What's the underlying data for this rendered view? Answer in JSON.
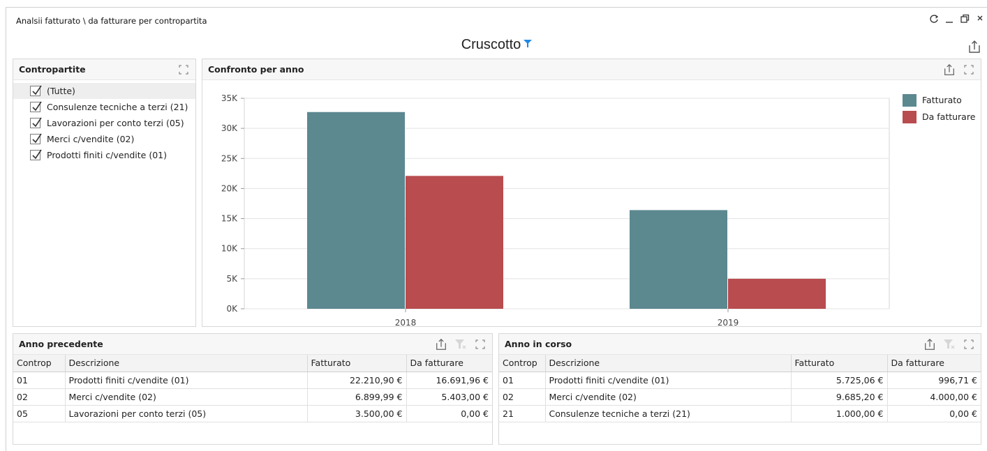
{
  "window": {
    "title": "Analsii fatturato \\ da fatturare per contropartita"
  },
  "dashboard": {
    "title": "Cruscotto"
  },
  "contropartite": {
    "title": "Contropartite",
    "items": [
      {
        "label": "(Tutte)",
        "checked": true
      },
      {
        "label": "Consulenze tecniche a terzi (21)",
        "checked": true
      },
      {
        "label": "Lavorazioni per conto terzi (05)",
        "checked": true
      },
      {
        "label": "Merci c/vendite (02)",
        "checked": true
      },
      {
        "label": "Prodotti finiti c/vendite (01)",
        "checked": true
      }
    ]
  },
  "chart_panel": {
    "title": "Confronto per anno"
  },
  "chart_data": {
    "type": "bar",
    "categories": [
      "2018",
      "2019"
    ],
    "series": [
      {
        "name": "Fatturato",
        "color": "#5c8890",
        "values": [
          32711,
          16410
        ]
      },
      {
        "name": "Da fatturare",
        "color": "#b84c4f",
        "values": [
          22095,
          4997
        ]
      }
    ],
    "ylim": [
      0,
      35000
    ],
    "yticks": [
      "0K",
      "5K",
      "10K",
      "15K",
      "20K",
      "25K",
      "30K",
      "35K"
    ],
    "grid": true,
    "legend": "top-right"
  },
  "prev_table": {
    "title": "Anno precedente",
    "columns": [
      "Controp",
      "Descrizione",
      "Fatturato",
      "Da fatturare"
    ],
    "rows": [
      [
        "01",
        "Prodotti finiti c/vendite (01)",
        "22.210,90 €",
        "16.691,96 €"
      ],
      [
        "02",
        "Merci c/vendite (02)",
        "6.899,99 €",
        "5.403,00 €"
      ],
      [
        "05",
        "Lavorazioni per conto terzi (05)",
        "3.500,00 €",
        "0,00 €"
      ]
    ]
  },
  "curr_table": {
    "title": "Anno in corso",
    "columns": [
      "Controp",
      "Descrizione",
      "Fatturato",
      "Da fatturare"
    ],
    "rows": [
      [
        "01",
        "Prodotti finiti c/vendite (01)",
        "5.725,06 €",
        "996,71 €"
      ],
      [
        "02",
        "Merci c/vendite (02)",
        "9.685,20 €",
        "4.000,00 €"
      ],
      [
        "21",
        "Consulenze tecniche a terzi (21)",
        "1.000,00 €",
        "0,00 €"
      ]
    ]
  },
  "colors": {
    "accent": "#1e88e5",
    "fatturato": "#5c8890",
    "da_fatturare": "#b84c4f"
  }
}
